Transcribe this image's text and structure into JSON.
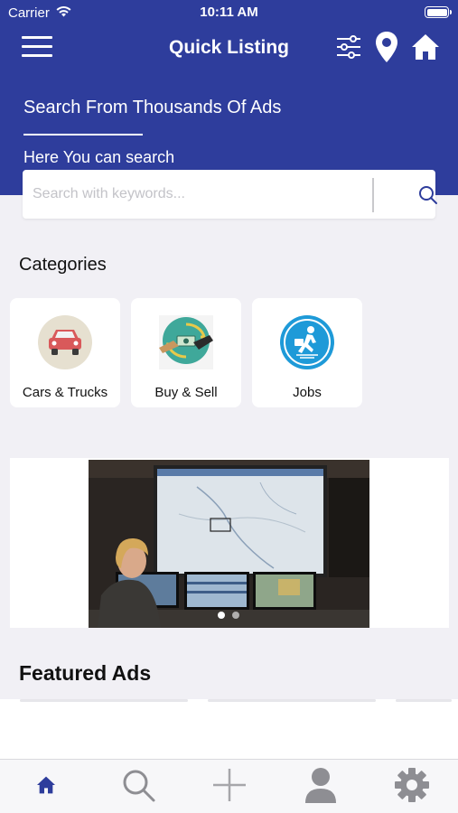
{
  "status_bar": {
    "carrier": "Carrier",
    "time": "10:11 AM",
    "icons": [
      "wifi-icon",
      "battery-icon"
    ]
  },
  "navbar": {
    "title": "Quick Listing",
    "icons": [
      "menu-icon",
      "filter-sliders-icon",
      "location-pin-icon",
      "home-icon"
    ]
  },
  "hero": {
    "title": "Search From Thousands Of Ads",
    "subtitle": "Here You can search"
  },
  "search": {
    "placeholder": "Search with keywords...",
    "value": "",
    "icon": "search-icon"
  },
  "categories": {
    "title": "Categories",
    "items": [
      {
        "label": "Cars & Trucks",
        "icon": "car-icon"
      },
      {
        "label": "Buy & Sell",
        "icon": "money-exchange-icon"
      },
      {
        "label": "Jobs",
        "icon": "running-person-briefcase-icon"
      }
    ]
  },
  "banner": {
    "slides": 2,
    "active_slide": 1
  },
  "featured": {
    "title": "Featured Ads"
  },
  "tabbar": {
    "tabs": [
      {
        "name": "home",
        "icon": "home-icon",
        "active": true
      },
      {
        "name": "search",
        "icon": "search-icon",
        "active": false
      },
      {
        "name": "add",
        "icon": "plus-icon",
        "active": false
      },
      {
        "name": "profile",
        "icon": "user-icon",
        "active": false
      },
      {
        "name": "settings",
        "icon": "gear-icon",
        "active": false
      }
    ]
  },
  "colors": {
    "primary": "#2e3d9c",
    "background": "#f1f0f5",
    "tab_inactive": "#8e8e93"
  }
}
